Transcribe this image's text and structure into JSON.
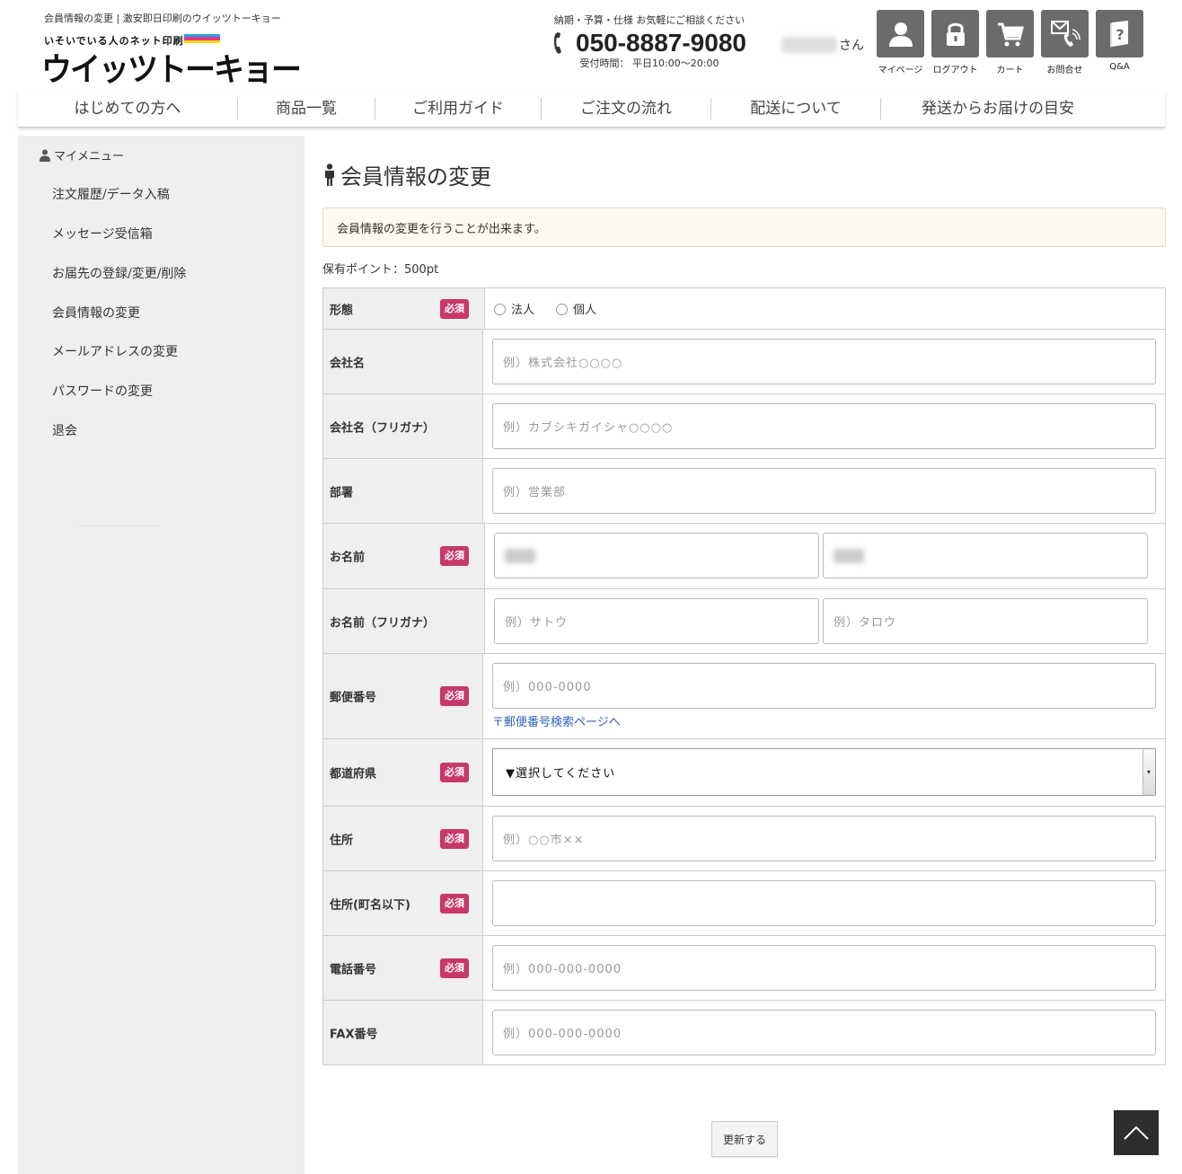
{
  "header": {
    "site_description": "会員情報の変更 | 激安即日印刷のウイッツトーキョー",
    "tagline": "いそいでいる人のネット印刷",
    "logo_text": "ウイッツトーキョー",
    "contact_note": "納期・予算・仕様 お気軽にご相談ください",
    "phone_number": "050-8887-9080",
    "hours": "受付時間： 平日10:00〜20:00",
    "user_suffix": "さん",
    "icons": [
      {
        "name": "mypage",
        "label": "マイページ",
        "icon": "person-icon"
      },
      {
        "name": "logout",
        "label": "ログアウト",
        "icon": "lock-icon"
      },
      {
        "name": "cart",
        "label": "カート",
        "icon": "cart-icon"
      },
      {
        "name": "contact",
        "label": "お問合せ",
        "icon": "mail-phone-icon"
      },
      {
        "name": "qa",
        "label": "Q&A",
        "icon": "question-book-icon"
      }
    ],
    "cmyk_colors": [
      "#1aa7e0",
      "#e8338c",
      "#f5e000"
    ]
  },
  "nav": {
    "items": [
      "はじめての方へ",
      "商品一覧",
      "ご利用ガイド",
      "ご注文の流れ",
      "配送について",
      "発送からお届けの目安"
    ]
  },
  "sidebar": {
    "title": "マイメニュー",
    "items": [
      "注文履歴/データ入稿",
      "メッセージ受信箱",
      "お届先の登録/変更/削除",
      "会員情報の変更",
      "メールアドレスの変更",
      "パスワードの変更",
      "退会"
    ]
  },
  "main": {
    "title": "会員情報の変更",
    "notice": "会員情報の変更を行うことが出来ます。",
    "points": "保有ポイント：500pt",
    "required_badge": "必須",
    "form": {
      "type_label": "形態",
      "type_options": [
        "法人",
        "個人"
      ],
      "company_label": "会社名",
      "company_placeholder": "例）株式会社○○○○",
      "company_kana_label": "会社名（フリガナ）",
      "company_kana_placeholder": "例）カブシキガイシャ○○○○",
      "department_label": "部署",
      "department_placeholder": "例）営業部",
      "name_label": "お名前",
      "name_kana_label": "お名前（フリガナ）",
      "name_kana_last_placeholder": "例）サトウ",
      "name_kana_first_placeholder": "例）タロウ",
      "zip_label": "郵便番号",
      "zip_placeholder": "例）000-0000",
      "zip_link": "〒郵便番号検索ページへ",
      "pref_label": "都道府県",
      "pref_selected": "▼選択してください",
      "address_label": "住所",
      "address_placeholder": "例）○○市××",
      "address2_label": "住所(町名以下)",
      "address2_placeholder": "",
      "tel_label": "電話番号",
      "tel_placeholder": "例）000-000-0000",
      "fax_label": "FAX番号",
      "fax_placeholder": "例）000-000-0000"
    },
    "submit_label": "更新する"
  },
  "colors": {
    "badge": "#c8386a",
    "icon_bg": "#6b6b6b",
    "notice_bg": "#fdf9ee",
    "sidebar_bg": "#efefef",
    "link": "#2f5fbf"
  }
}
